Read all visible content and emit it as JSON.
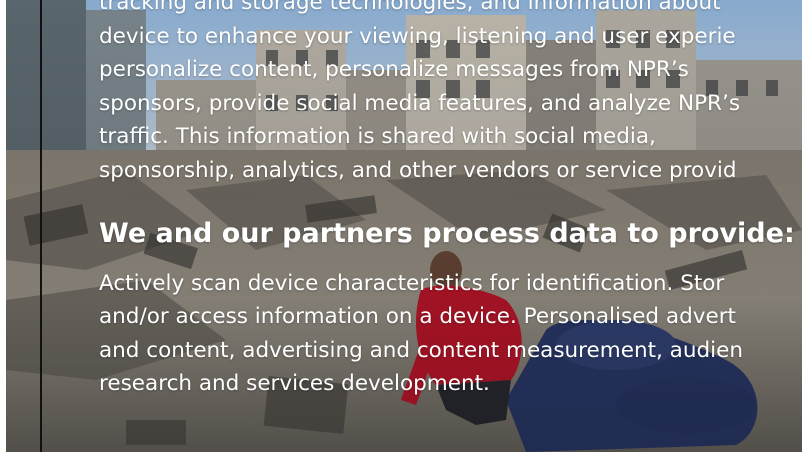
{
  "consent": {
    "intro_lines": [
      "tracking and storage technologies, and information about",
      "device to enhance your viewing, listening and user experie",
      "personalize content, personalize messages from NPR’s",
      "sponsors, provide social media features, and analyze NPR’s",
      "traffic. This information is shared with social media,",
      "sponsorship, analytics, and other vendors or service provid"
    ],
    "heading": "We and our partners process data to provide:",
    "purposes_lines": [
      "Actively scan device characteristics for identification. Stor",
      "and/or access information on a device. Personalised advert",
      "and content, advertising and content measurement, audien",
      "research and services development."
    ]
  },
  "background_image": {
    "subject": "man-in-red-hoodie-amid-rubble"
  }
}
